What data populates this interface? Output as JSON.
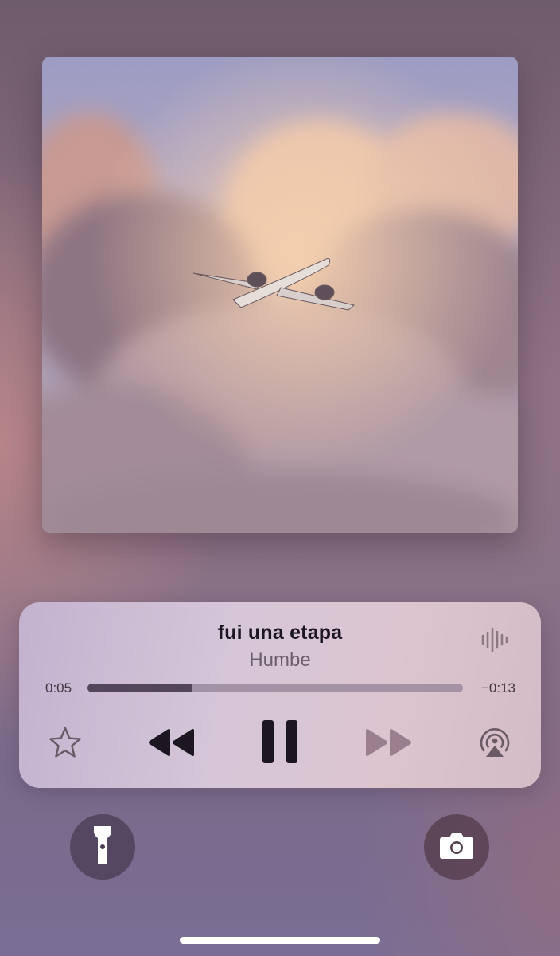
{
  "now_playing": {
    "title": "fui una etapa",
    "artist": "Humbe",
    "elapsed": "0:05",
    "remaining": "−0:13",
    "progress": 0.28
  },
  "icons": {
    "waveform": "waveform-icon",
    "favorite": "star-icon",
    "previous": "backward-icon",
    "play_pause": "pause-icon",
    "next": "forward-icon",
    "output": "airplay-icon",
    "flashlight": "flashlight-icon",
    "camera": "camera-icon"
  },
  "colors": {
    "card": "#d6c6d8",
    "progress_fill": "#54465a",
    "progress_track": "#a391a6",
    "control": "#1c1620",
    "control_disabled": "#9a7f8e"
  }
}
